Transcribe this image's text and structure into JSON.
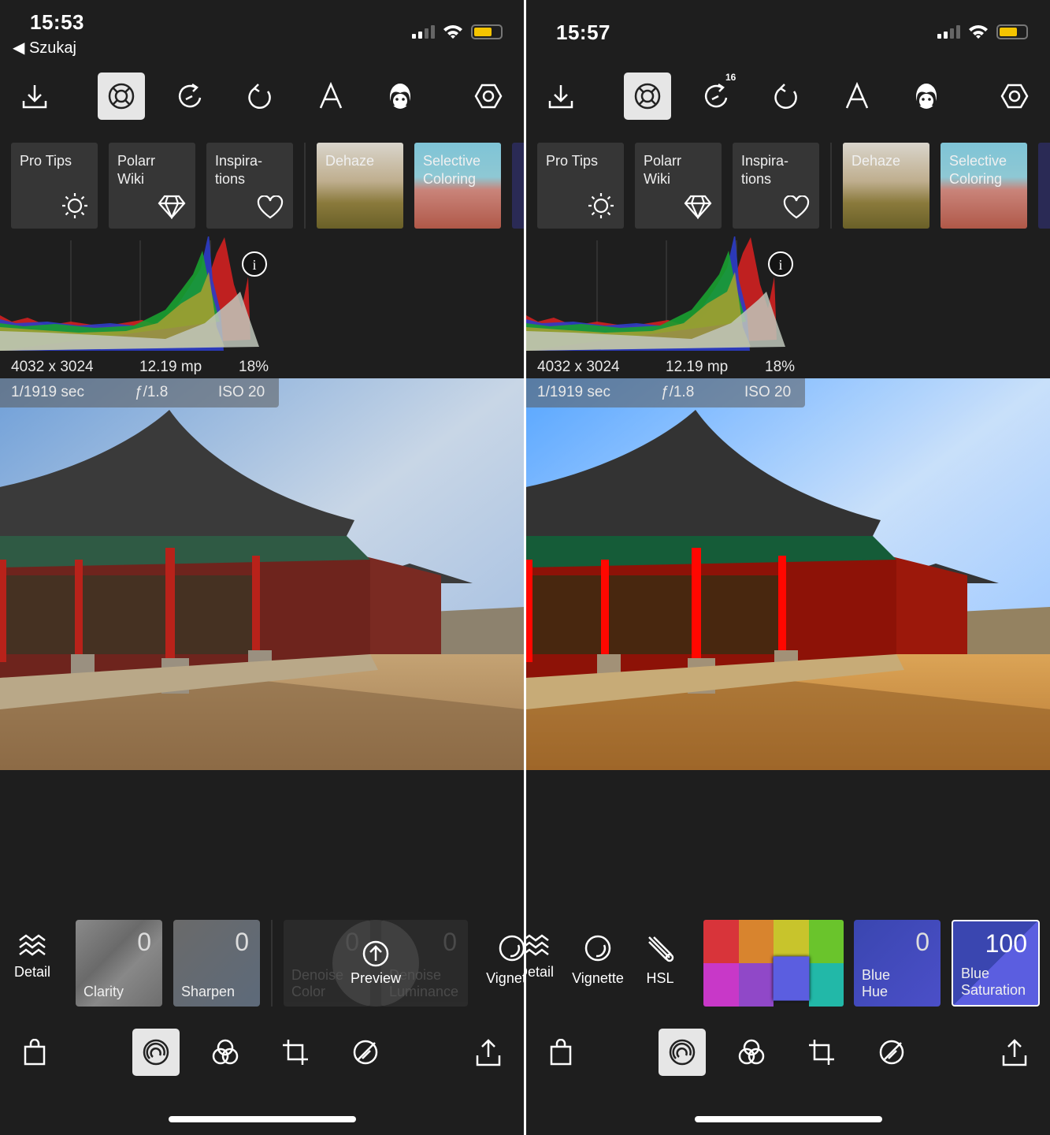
{
  "left": {
    "status": {
      "time": "15:53",
      "back_label": "Szukaj"
    },
    "cards": [
      {
        "title": "Pro Tips",
        "icon": "sun-icon"
      },
      {
        "title": "Polarr Wiki",
        "icon": "diamond-icon"
      },
      {
        "title": "Inspira-tions",
        "icon": "heart-icon"
      },
      {
        "title": "Dehaze"
      },
      {
        "title": "Selective Coloring"
      }
    ],
    "info": {
      "dimensions": "4032 x 3024",
      "megapixels": "12.19 mp",
      "percent": "18%",
      "shutter": "1/1919 sec",
      "aperture": "ƒ/1.8",
      "iso": "ISO 20"
    },
    "tools": {
      "detail": "Detail",
      "clarity": {
        "label": "Clarity",
        "value": "0"
      },
      "sharpen": {
        "label": "Sharpen",
        "value": "0"
      },
      "denoise_color": {
        "label": "Denoise Color",
        "value": "0"
      },
      "denoise_luminance": {
        "label": "Denoise Luminance",
        "value": "0"
      },
      "preview": "Preview",
      "vignette": "Vignette"
    }
  },
  "right": {
    "status": {
      "time": "15:57"
    },
    "redo_count": "16",
    "cards": [
      {
        "title": "Pro Tips"
      },
      {
        "title": "Polarr Wiki"
      },
      {
        "title": "Inspira-tions"
      },
      {
        "title": "Dehaze"
      },
      {
        "title": "Selective Coloring"
      }
    ],
    "info": {
      "dimensions": "4032 x 3024",
      "megapixels": "12.19 mp",
      "percent": "18%",
      "shutter": "1/1919 sec",
      "aperture": "ƒ/1.8",
      "iso": "ISO 20"
    },
    "tools": {
      "detail": "Detail",
      "vignette": "Vignette",
      "hsl": "HSL",
      "blue_hue": {
        "label": "Blue Hue",
        "value": "0"
      },
      "blue_saturation": {
        "label": "Blue Saturation",
        "value": "100"
      }
    }
  },
  "colors": {
    "battery": "#f5c400",
    "selected_blue": "#5b5ee0"
  }
}
